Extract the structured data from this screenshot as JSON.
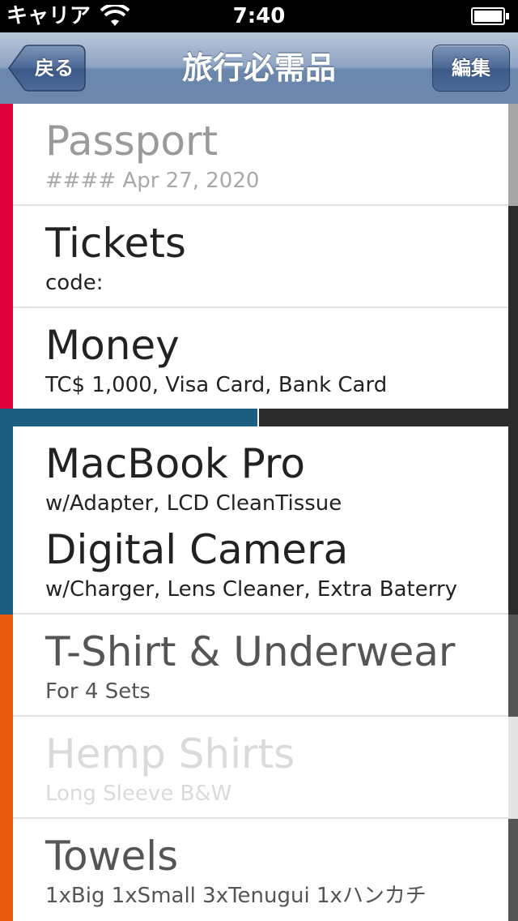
{
  "status_bar": {
    "carrier": "キャリア",
    "time": "7:40",
    "battery_level": 1.0
  },
  "nav": {
    "back_label": "戻る",
    "title": "旅行必需品",
    "edit_label": "編集"
  },
  "colors": {
    "red": "#e0003e",
    "blue": "#1b5e82",
    "orange": "#ea5a10",
    "dark": "#2b2b2b",
    "grey": "#a9a9a9"
  },
  "items": [
    {
      "title": "Passport",
      "subtitle": "#### Apr 27, 2020",
      "category_color": "#e0003e",
      "state": "dimmed"
    },
    {
      "title": "Tickets",
      "subtitle": "code:",
      "category_color": "#e0003e",
      "state": "active"
    },
    {
      "title": "Money",
      "subtitle": "TC$ 1,000, Visa Card, Bank Card",
      "category_color": "#e0003e",
      "state": "active"
    },
    {
      "title": "MacBook Pro",
      "subtitle": "w/Adapter, LCD CleanTissue",
      "category_color": "#1b5e82",
      "state": "active"
    },
    {
      "title": "Digital Camera",
      "subtitle": "w/Charger, Lens Cleaner, Extra Baterry",
      "category_color": "#1b5e82",
      "state": "active"
    },
    {
      "title": "T-Shirt & Underwear",
      "subtitle": "For 4 Sets",
      "category_color": "#ea5a10",
      "state": "partial"
    },
    {
      "title": "Hemp Shirts",
      "subtitle": "Long Sleeve B&W",
      "category_color": "#ea5a10",
      "state": "faded"
    },
    {
      "title": "Towels",
      "subtitle": "1xBig 1xSmall 3xTenugui 1xハンカチ",
      "category_color": "#ea5a10",
      "state": "partial"
    }
  ],
  "section_progress": {
    "fraction": 0.5,
    "done_color": "#1b5e82",
    "rest_color": "#2b2b2b"
  }
}
